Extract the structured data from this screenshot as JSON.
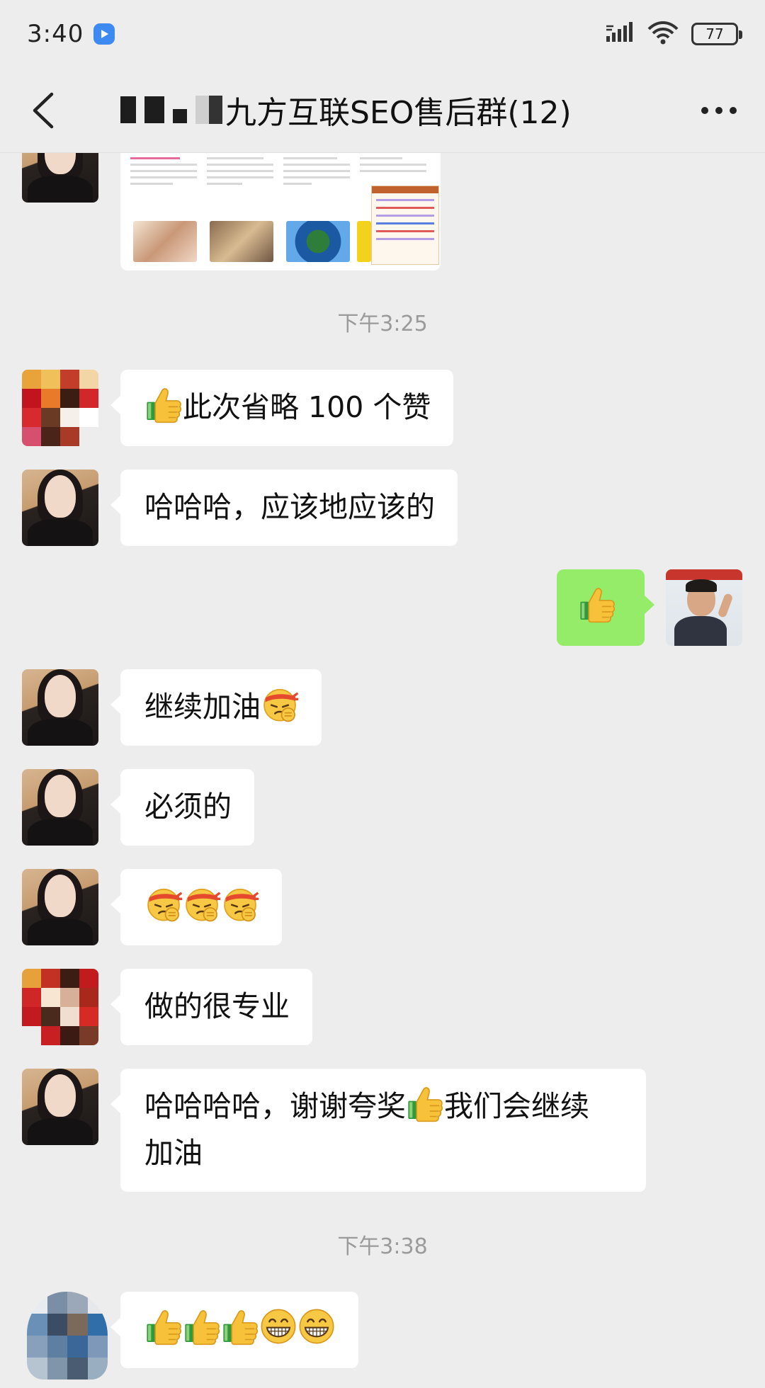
{
  "status_bar": {
    "time": "3:40",
    "battery": "77"
  },
  "nav": {
    "title": "九方互联SEO售后群(12)"
  },
  "colors": {
    "background": "#ededed",
    "bubble_incoming": "#ffffff",
    "bubble_outgoing": "#95ec69",
    "timestamp_text": "#9a9a9a"
  },
  "messages": [
    {
      "type": "image",
      "sender": "group-member-a",
      "side": "left"
    },
    {
      "type": "timestamp",
      "text": "下午3:25"
    },
    {
      "type": "text",
      "sender": "group-member-b",
      "side": "left",
      "prefix_icon": "thumbs-up-icon",
      "text": "此次省略 100 个赞"
    },
    {
      "type": "text",
      "sender": "group-member-a",
      "side": "left",
      "text": "哈哈哈，应该地应该的"
    },
    {
      "type": "emoji",
      "sender": "me",
      "side": "right",
      "icon": "thumbs-up-icon"
    },
    {
      "type": "text",
      "sender": "group-member-a",
      "side": "left",
      "text": "继续加油",
      "suffix_icon": "fighting-face-icon"
    },
    {
      "type": "text",
      "sender": "group-member-a",
      "side": "left",
      "text": "必须的"
    },
    {
      "type": "emoji",
      "sender": "group-member-a",
      "side": "left",
      "icons": [
        "fighting-face-icon",
        "fighting-face-icon",
        "fighting-face-icon"
      ]
    },
    {
      "type": "text",
      "sender": "group-member-c",
      "side": "left",
      "text": "做的很专业"
    },
    {
      "type": "text",
      "sender": "group-member-a",
      "side": "left",
      "text_part1": "哈哈哈哈，谢谢夸奖",
      "inline_icon": "thumbs-up-icon",
      "text_part2": "我们会继续",
      "text_line2": "加油"
    },
    {
      "type": "timestamp",
      "text": "下午3:38"
    },
    {
      "type": "emoji",
      "sender": "group-member-d",
      "side": "left",
      "icons": [
        "thumbs-up-icon",
        "thumbs-up-icon",
        "thumbs-up-icon",
        "grin-face-icon",
        "grin-face-icon"
      ]
    }
  ]
}
